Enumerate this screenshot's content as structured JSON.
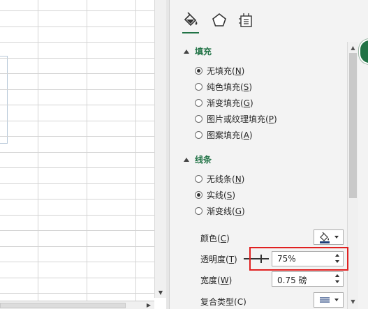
{
  "pane": {
    "tabs": [
      {
        "name": "fill-line-icon",
        "active": true
      },
      {
        "name": "effects-pentagon-icon",
        "active": false
      },
      {
        "name": "size-properties-icon",
        "active": false
      }
    ],
    "fill_section": {
      "title": "填充",
      "options": [
        {
          "text": "无填充(",
          "key": "N",
          "tail": ")",
          "checked": true
        },
        {
          "text": "纯色填充(",
          "key": "S",
          "tail": ")",
          "checked": false
        },
        {
          "text": "渐变填充(",
          "key": "G",
          "tail": ")",
          "checked": false
        },
        {
          "text": "图片或纹理填充(",
          "key": "P",
          "tail": ")",
          "checked": false
        },
        {
          "text": "图案填充(",
          "key": "A",
          "tail": ")",
          "checked": false
        }
      ]
    },
    "line_section": {
      "title": "线条",
      "options": [
        {
          "text": "无线条(",
          "key": "N",
          "tail": ")",
          "checked": false
        },
        {
          "text": "实线(",
          "key": "S",
          "tail": ")",
          "checked": true
        },
        {
          "text": "渐变线(",
          "key": "G",
          "tail": ")",
          "checked": false
        }
      ]
    },
    "properties": {
      "color_label": "颜色(",
      "color_key": "C",
      "color_tail": ")",
      "transparency_label": "透明度(",
      "transparency_key": "T",
      "transparency_tail": ")",
      "transparency_value": "75%",
      "width_label": "宽度(",
      "width_key": "W",
      "width_tail": ")",
      "width_value": "0.75 磅",
      "compound_label": "复合类型(",
      "compound_key": "C",
      "compound_tail": ")"
    },
    "accent_color": "#217346",
    "highlight_color": "#e02020"
  }
}
